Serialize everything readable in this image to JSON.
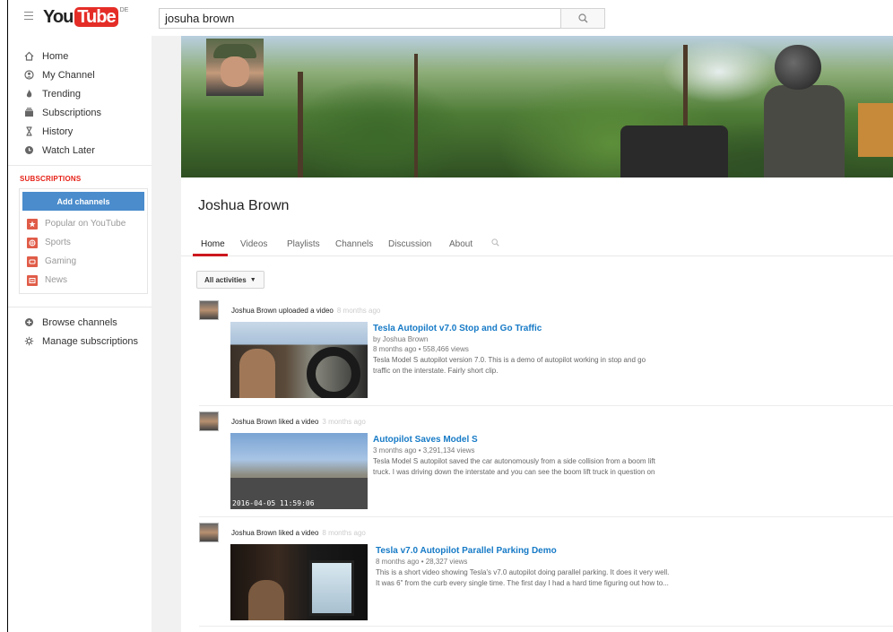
{
  "masthead": {
    "logo_you": "You",
    "logo_tube": "Tube",
    "logo_country": "DE",
    "search_value": "josuha brown"
  },
  "sidebar": {
    "nav": [
      {
        "label": "Home",
        "icon": "home-icon"
      },
      {
        "label": "My Channel",
        "icon": "person-icon"
      },
      {
        "label": "Trending",
        "icon": "flame-icon"
      },
      {
        "label": "Subscriptions",
        "icon": "subscriptions-icon"
      },
      {
        "label": "History",
        "icon": "hourglass-icon"
      },
      {
        "label": "Watch Later",
        "icon": "clock-icon"
      }
    ],
    "subscriptions_title": "SUBSCRIPTIONS",
    "add_channels": "Add channels",
    "subscriptions": [
      {
        "label": "Popular on YouTube",
        "color": "#e2453c"
      },
      {
        "label": "Sports",
        "color": "#e2453c"
      },
      {
        "label": "Gaming",
        "color": "#e2453c"
      },
      {
        "label": "News",
        "color": "#e2453c"
      }
    ],
    "browse_channels": "Browse channels",
    "manage_subscriptions": "Manage subscriptions"
  },
  "channel": {
    "name": "Joshua Brown",
    "tabs": [
      "Home",
      "Videos",
      "Playlists",
      "Channels",
      "Discussion",
      "About"
    ],
    "all_activities": "All activities",
    "accent_color": "#cc181e",
    "link_color": "#167ac6"
  },
  "feed": [
    {
      "action": "Joshua Brown uploaded a video",
      "time": "8 months ago",
      "title": "Tesla Autopilot v7.0 Stop and Go Traffic",
      "byline": "by Joshua Brown",
      "meta": "8 months ago • 558,466 views",
      "desc1": "Tesla Model S autopilot version 7.0. This is a demo of autopilot working in stop and go",
      "desc2": "traffic on the interstate. Fairly short clip."
    },
    {
      "action": "Joshua Brown liked a video",
      "time": "3 months ago",
      "title": "Autopilot Saves Model S",
      "meta": "3 months ago • 3,291,134 views",
      "desc1": "Tesla Model S autopilot saved the car autonomously from a side collision from a boom lift",
      "desc2": "truck. I was driving down the interstate and you can see the boom lift truck in question on",
      "thumb_timestamp": "2016-04-05 11:59:06"
    },
    {
      "action": "Joshua Brown liked a video",
      "time": "8 months ago",
      "title": "Tesla v7.0 Autopilot Parallel Parking Demo",
      "meta": "8 months ago • 28,327 views",
      "desc1": "This is a short video showing Tesla's v7.0 autopilot doing parallel parking. It does it very well.",
      "desc2": "It was 6\" from the curb every single time. The first day I had a hard time figuring out how to..."
    }
  ]
}
